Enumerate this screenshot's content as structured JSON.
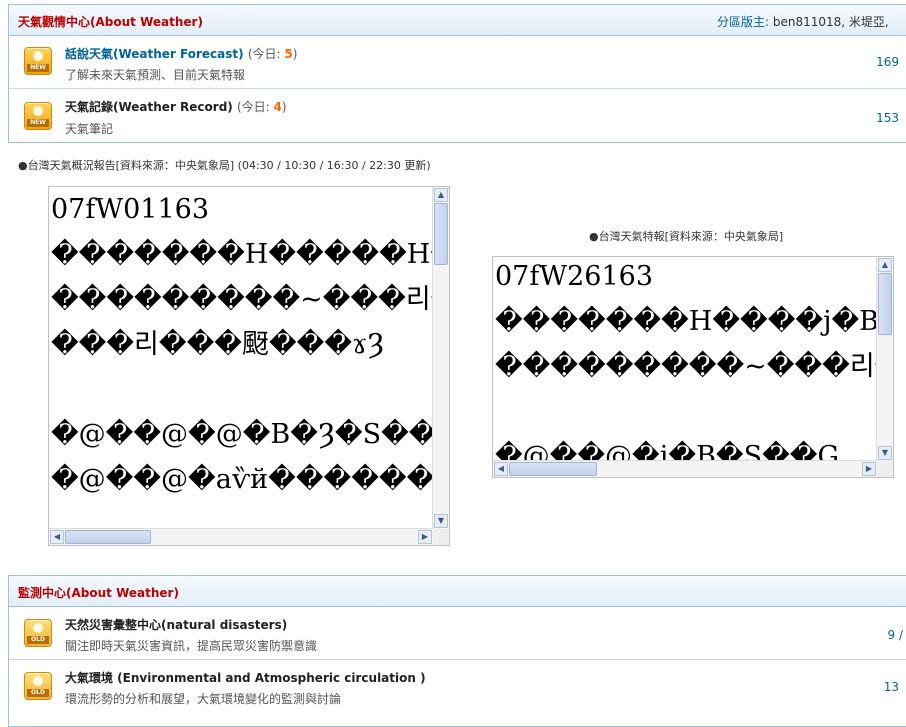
{
  "weather_section": {
    "title": "天氣觀情中心(About Weather)",
    "moderators_label": "分區版主:",
    "moderators": "ben811018, 米堤亞,",
    "forums": [
      {
        "title": "話說天氣(Weather Forecast)",
        "today_label": "(今日: ",
        "today_count": "5",
        "today_close": ")",
        "desc": "了解未來天氣預測、目前天氣特報",
        "count": "169",
        "icon": "new-icon",
        "icon_text": "NEW"
      },
      {
        "title": "天氣記錄(Weather Record)",
        "today_label": "(今日: ",
        "today_count": "4",
        "today_close": ")",
        "desc": "天氣筆記",
        "count": "153",
        "icon": "new-icon",
        "icon_text": "NEW"
      }
    ]
  },
  "report": {
    "caption": "●台灣天氣概況報告[資料來源：中央氣象局] (04:30 / 10:30 / 16:30 / 22:30 更新)",
    "lines": [
      "07fW01163",
      "�������H�����H�",
      "���������~���리�",
      "���리���颬���ɤȜ",
      "",
      "�@��@�@�B�Ȝ�S��G",
      "�@��@�aѷй������օ��"
    ]
  },
  "special": {
    "caption": "●台灣天氣特報[資料來源：中央氣象局]",
    "lines": [
      "07fW26163",
      "�������H����j�B�",
      "���������~���리�",
      "",
      "�@��@�i�B�S��G"
    ]
  },
  "monitor_section": {
    "title": "監測中心(About Weather)",
    "forums": [
      {
        "title": "天然災害彙整中心(natural disasters)",
        "desc": "關注即時天氣災害資訊，提高民眾災害防禦意識",
        "count": "9 /",
        "icon": "old-icon",
        "icon_text": "OLD"
      },
      {
        "title": "大氣環境 (Environmental and Atmospheric circulation )",
        "desc": "環流形勢的分析和展望，大氣環境變化的監測與討論",
        "count": "13",
        "icon": "old-icon",
        "icon_text": "OLD"
      }
    ]
  },
  "colors": {
    "section_title": "#bb0000",
    "link": "#00629b",
    "today_count": "#ff6600",
    "border": "#9dc1dc"
  }
}
